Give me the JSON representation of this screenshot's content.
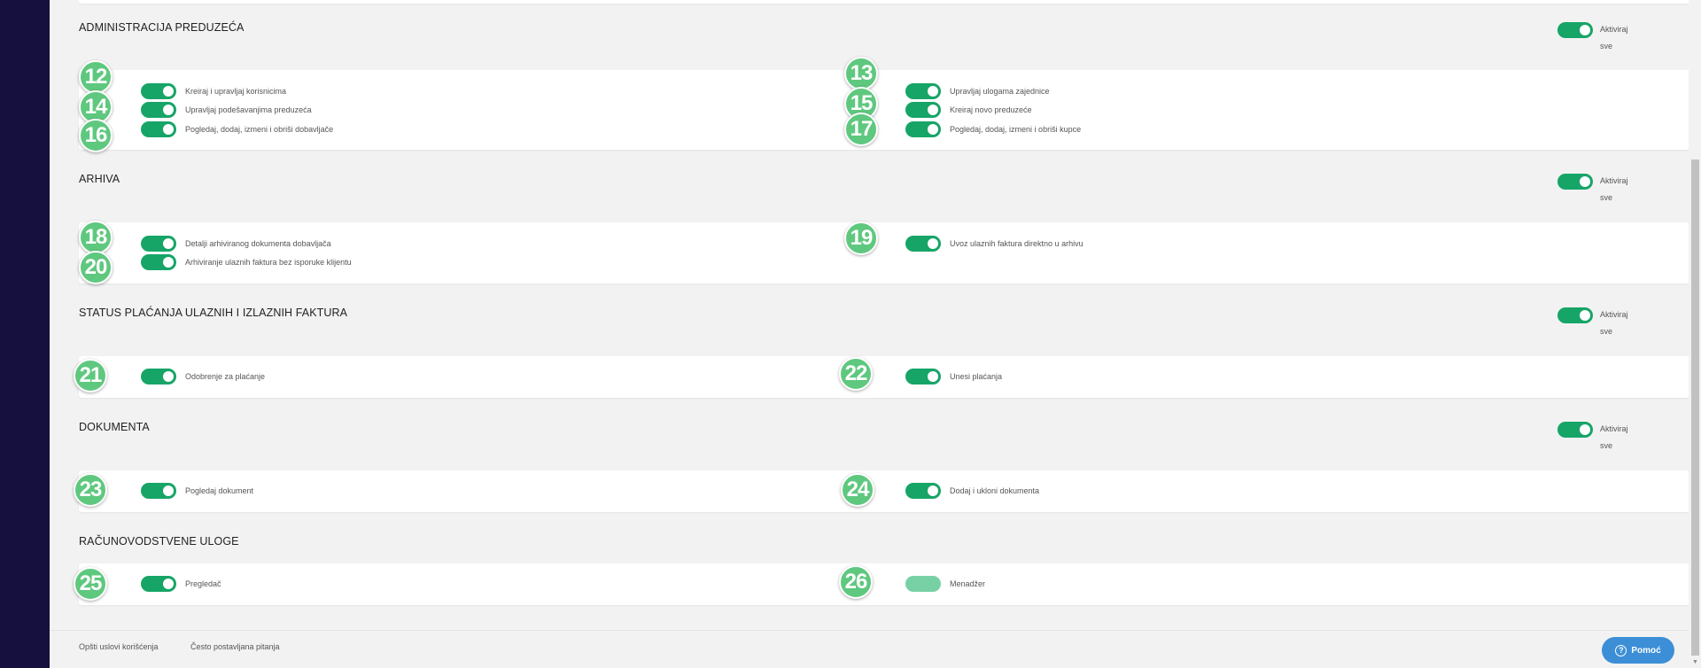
{
  "sections": [
    {
      "title": "ADMINISTRACIJA PREDUZEĆA",
      "activate_label": "Aktiviraj sve",
      "items": [
        {
          "badge": "12",
          "label": "Kreiraj i upravljaj korisnicima"
        },
        {
          "badge": "13",
          "label": "Upravljaj ulogama zajednice"
        },
        {
          "badge": "14",
          "label": "Upravljaj podešavanjima preduzeća"
        },
        {
          "badge": "15",
          "label": "Kreiraj novo preduzeće"
        },
        {
          "badge": "16",
          "label": "Pogledaj, dodaj, izmeni i obriši dobavljače"
        },
        {
          "badge": "17",
          "label": "Pogledaj, dodaj, izmeni i obriši kupce"
        }
      ]
    },
    {
      "title": "ARHIVA",
      "activate_label": "Aktiviraj sve",
      "items": [
        {
          "badge": "18",
          "label": "Detalji arhiviranog dokumenta dobavljača"
        },
        {
          "badge": "19",
          "label": "Uvoz ulaznih faktura direktno u arhivu"
        },
        {
          "badge": "20",
          "label": "Arhiviranje ulaznih faktura bez isporuke klijentu"
        }
      ]
    },
    {
      "title": "STATUS PLAĆANJA ULAZNIH I IZLAZNIH FAKTURA",
      "activate_label": "Aktiviraj sve",
      "items": [
        {
          "badge": "21",
          "label": "Odobrenje za plaćanje"
        },
        {
          "badge": "22",
          "label": "Unesi plaćanja"
        }
      ]
    },
    {
      "title": "DOKUMENTA",
      "activate_label": "Aktiviraj sve",
      "items": [
        {
          "badge": "23",
          "label": "Pogledaj dokument"
        },
        {
          "badge": "24",
          "label": "Dodaj i ukloni dokumenta"
        }
      ]
    },
    {
      "title": "RAČUNOVODSTVENE ULOGE",
      "items": [
        {
          "badge": "25",
          "label": "Pregledač"
        },
        {
          "badge": "26",
          "label": "Menadžer",
          "toggle_state": "disabled"
        }
      ]
    }
  ],
  "footer": {
    "terms": "Opšti uslovi korišćenja",
    "faq": "Često postavljana pitanja",
    "help_button": "Pomoć",
    "help_icon": "question-circle-icon"
  },
  "colors": {
    "toggle_on": "#16a567",
    "toggle_disabled": "#77d1a5",
    "badge": "#5fc87f",
    "sidebar": "#15103d",
    "help_button": "#3c8fd6"
  }
}
